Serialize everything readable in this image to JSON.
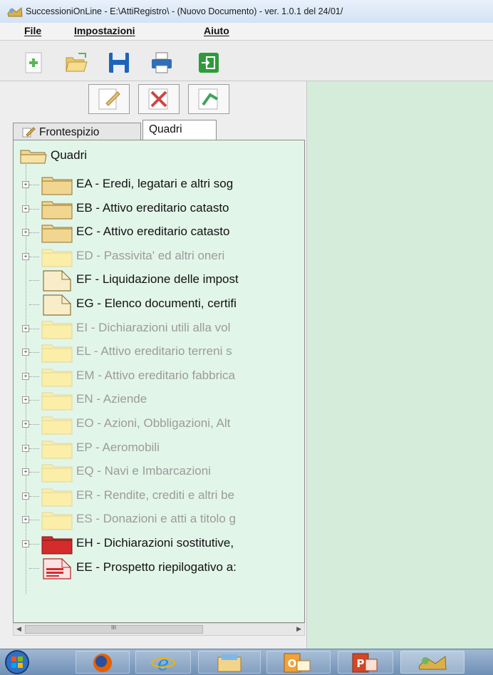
{
  "window": {
    "title": "SuccessioniOnLine - E:\\AttiRegistro\\ - (Nuovo Documento)  -  ver. 1.0.1 del 24/01/"
  },
  "menu": {
    "items": [
      {
        "label": "File"
      },
      {
        "label": "Impostazioni"
      },
      {
        "label": "Aiuto"
      }
    ]
  },
  "toolbar": {
    "buttons": [
      "new-document-icon",
      "open-folder-icon",
      "save-icon",
      "print-icon",
      "exit-icon"
    ]
  },
  "left_toolbar": {
    "buttons": [
      "edit-icon",
      "delete-icon",
      "confirm-icon"
    ]
  },
  "tabs": [
    {
      "label": "Frontespizio",
      "active": false
    },
    {
      "label": "Quadri",
      "active": true
    }
  ],
  "tree": {
    "root_label": "Quadri",
    "items": [
      {
        "label": "EA - Eredi, legatari e altri sog",
        "state": "active",
        "icon": "folder",
        "expander": true
      },
      {
        "label": "EB - Attivo ereditario catasto",
        "state": "active",
        "icon": "folder",
        "expander": true
      },
      {
        "label": "EC - Attivo ereditario catasto",
        "state": "active",
        "icon": "folder",
        "expander": true
      },
      {
        "label": "ED - Passivita' ed altri oneri",
        "state": "inactive",
        "icon": "folder",
        "expander": true
      },
      {
        "label": "EF - Liquidazione delle impost",
        "state": "active",
        "icon": "document",
        "expander": false
      },
      {
        "label": "EG - Elenco documenti, certifi",
        "state": "active",
        "icon": "document",
        "expander": false
      },
      {
        "label": "EI - Dichiarazioni utili alla vol",
        "state": "inactive",
        "icon": "folder",
        "expander": true
      },
      {
        "label": "EL - Attivo ereditario terreni s",
        "state": "inactive",
        "icon": "folder",
        "expander": true
      },
      {
        "label": "EM - Attivo ereditario fabbrica",
        "state": "inactive",
        "icon": "folder",
        "expander": true
      },
      {
        "label": "EN - Aziende",
        "state": "inactive",
        "icon": "folder",
        "expander": true
      },
      {
        "label": "EO - Azioni, Obbligazioni, Alt",
        "state": "inactive",
        "icon": "folder",
        "expander": true
      },
      {
        "label": "EP - Aeromobili",
        "state": "inactive",
        "icon": "folder",
        "expander": true
      },
      {
        "label": "EQ - Navi e Imbarcazioni",
        "state": "inactive",
        "icon": "folder",
        "expander": true
      },
      {
        "label": "ER - Rendite, crediti e altri be",
        "state": "inactive",
        "icon": "folder",
        "expander": true
      },
      {
        "label": "ES - Donazioni e atti a titolo g",
        "state": "inactive",
        "icon": "folder",
        "expander": true
      },
      {
        "label": "EH - Dichiarazioni sostitutive,",
        "state": "active",
        "icon": "folder-red",
        "expander": true
      },
      {
        "label": "EE - Prospetto riepilogativo a:",
        "state": "active",
        "icon": "document-red",
        "expander": false
      }
    ]
  },
  "scrollbar": {
    "grip": "III"
  },
  "taskbar": {
    "items": [
      "start-orb-icon",
      "firefox-icon",
      "internet-explorer-icon",
      "file-explorer-icon",
      "outlook-icon",
      "powerpoint-icon",
      "successioni-app-icon"
    ]
  },
  "colors": {
    "tree_bg": "#e2f5e9",
    "right_bg": "#d6ecda",
    "inactive_text": "#9b9b9b",
    "folder_active": "#f1d68f",
    "folder_inactive": "#fbeea8",
    "folder_red": "#d42b2b"
  }
}
